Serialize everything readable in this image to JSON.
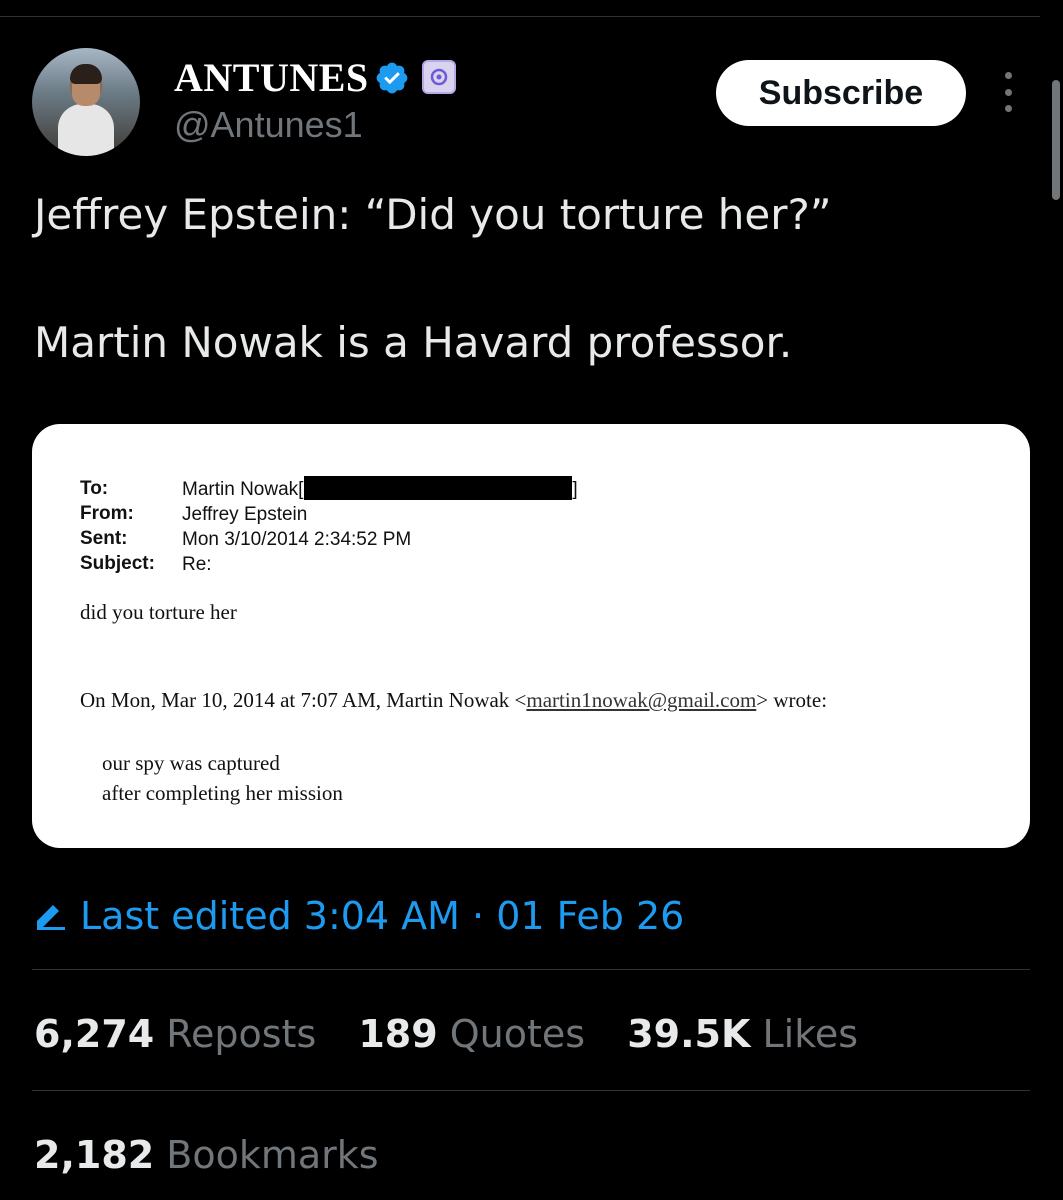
{
  "author": {
    "display_name": "ANTUNES",
    "handle": "@Antunes1"
  },
  "actions": {
    "subscribe_label": "Subscribe"
  },
  "post": {
    "line1": "Jeffrey Epstein: “Did you torture her?”",
    "line2": "Martin Nowak is a Havard professor."
  },
  "email": {
    "labels": [
      "To:",
      "From:",
      "Sent:",
      "Subject:"
    ],
    "to": "Martin Nowak[",
    "to_end": "]",
    "from": "Jeffrey Epstein",
    "sent": "Mon 3/10/2014 2:34:52 PM",
    "subject": "Re:",
    "body": "did you torture her",
    "quote_intro_start": "On Mon, Mar 10, 2014 at 7:07 AM, Martin Nowak <",
    "quote_email": "martin1nowak@gmail.com",
    "quote_intro_end": "> wrote:",
    "quote_line1": "our spy was captured",
    "quote_line2": "after completing her mission"
  },
  "edit_info": "Last edited 3:04 AM · 01 Feb 26",
  "stats": {
    "reposts_count": "6,274",
    "reposts_label": "Reposts",
    "quotes_count": "189",
    "quotes_label": "Quotes",
    "likes_count": "39.5K",
    "likes_label": "Likes",
    "bookmarks_count": "2,182",
    "bookmarks_label": "Bookmarks"
  },
  "colors": {
    "background": "#000000",
    "link_blue": "#1d9bf0",
    "muted": "#71767b"
  }
}
